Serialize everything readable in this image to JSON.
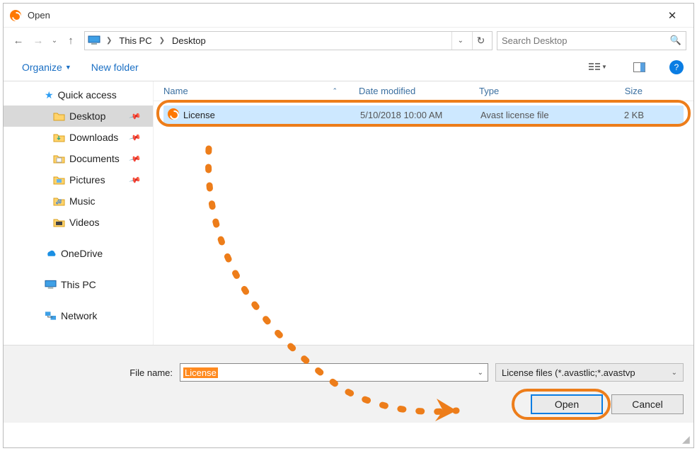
{
  "titlebar": {
    "title": "Open"
  },
  "breadcrumb": {
    "root": "This PC",
    "current": "Desktop"
  },
  "search": {
    "placeholder": "Search Desktop"
  },
  "toolbar": {
    "organize": "Organize",
    "newfolder": "New folder"
  },
  "sidebar": {
    "quick": "Quick access",
    "desktop": "Desktop",
    "downloads": "Downloads",
    "documents": "Documents",
    "pictures": "Pictures",
    "music": "Music",
    "videos": "Videos",
    "onedrive": "OneDrive",
    "thispc": "This PC",
    "network": "Network"
  },
  "columns": {
    "name": "Name",
    "date": "Date modified",
    "type": "Type",
    "size": "Size"
  },
  "file": {
    "name": "License",
    "date": "5/10/2018 10:00 AM",
    "type": "Avast license file",
    "size": "2 KB"
  },
  "footer": {
    "label": "File name:",
    "value": "License",
    "filter": "License files (*.avastlic;*.avastvp",
    "open": "Open",
    "cancel": "Cancel"
  }
}
